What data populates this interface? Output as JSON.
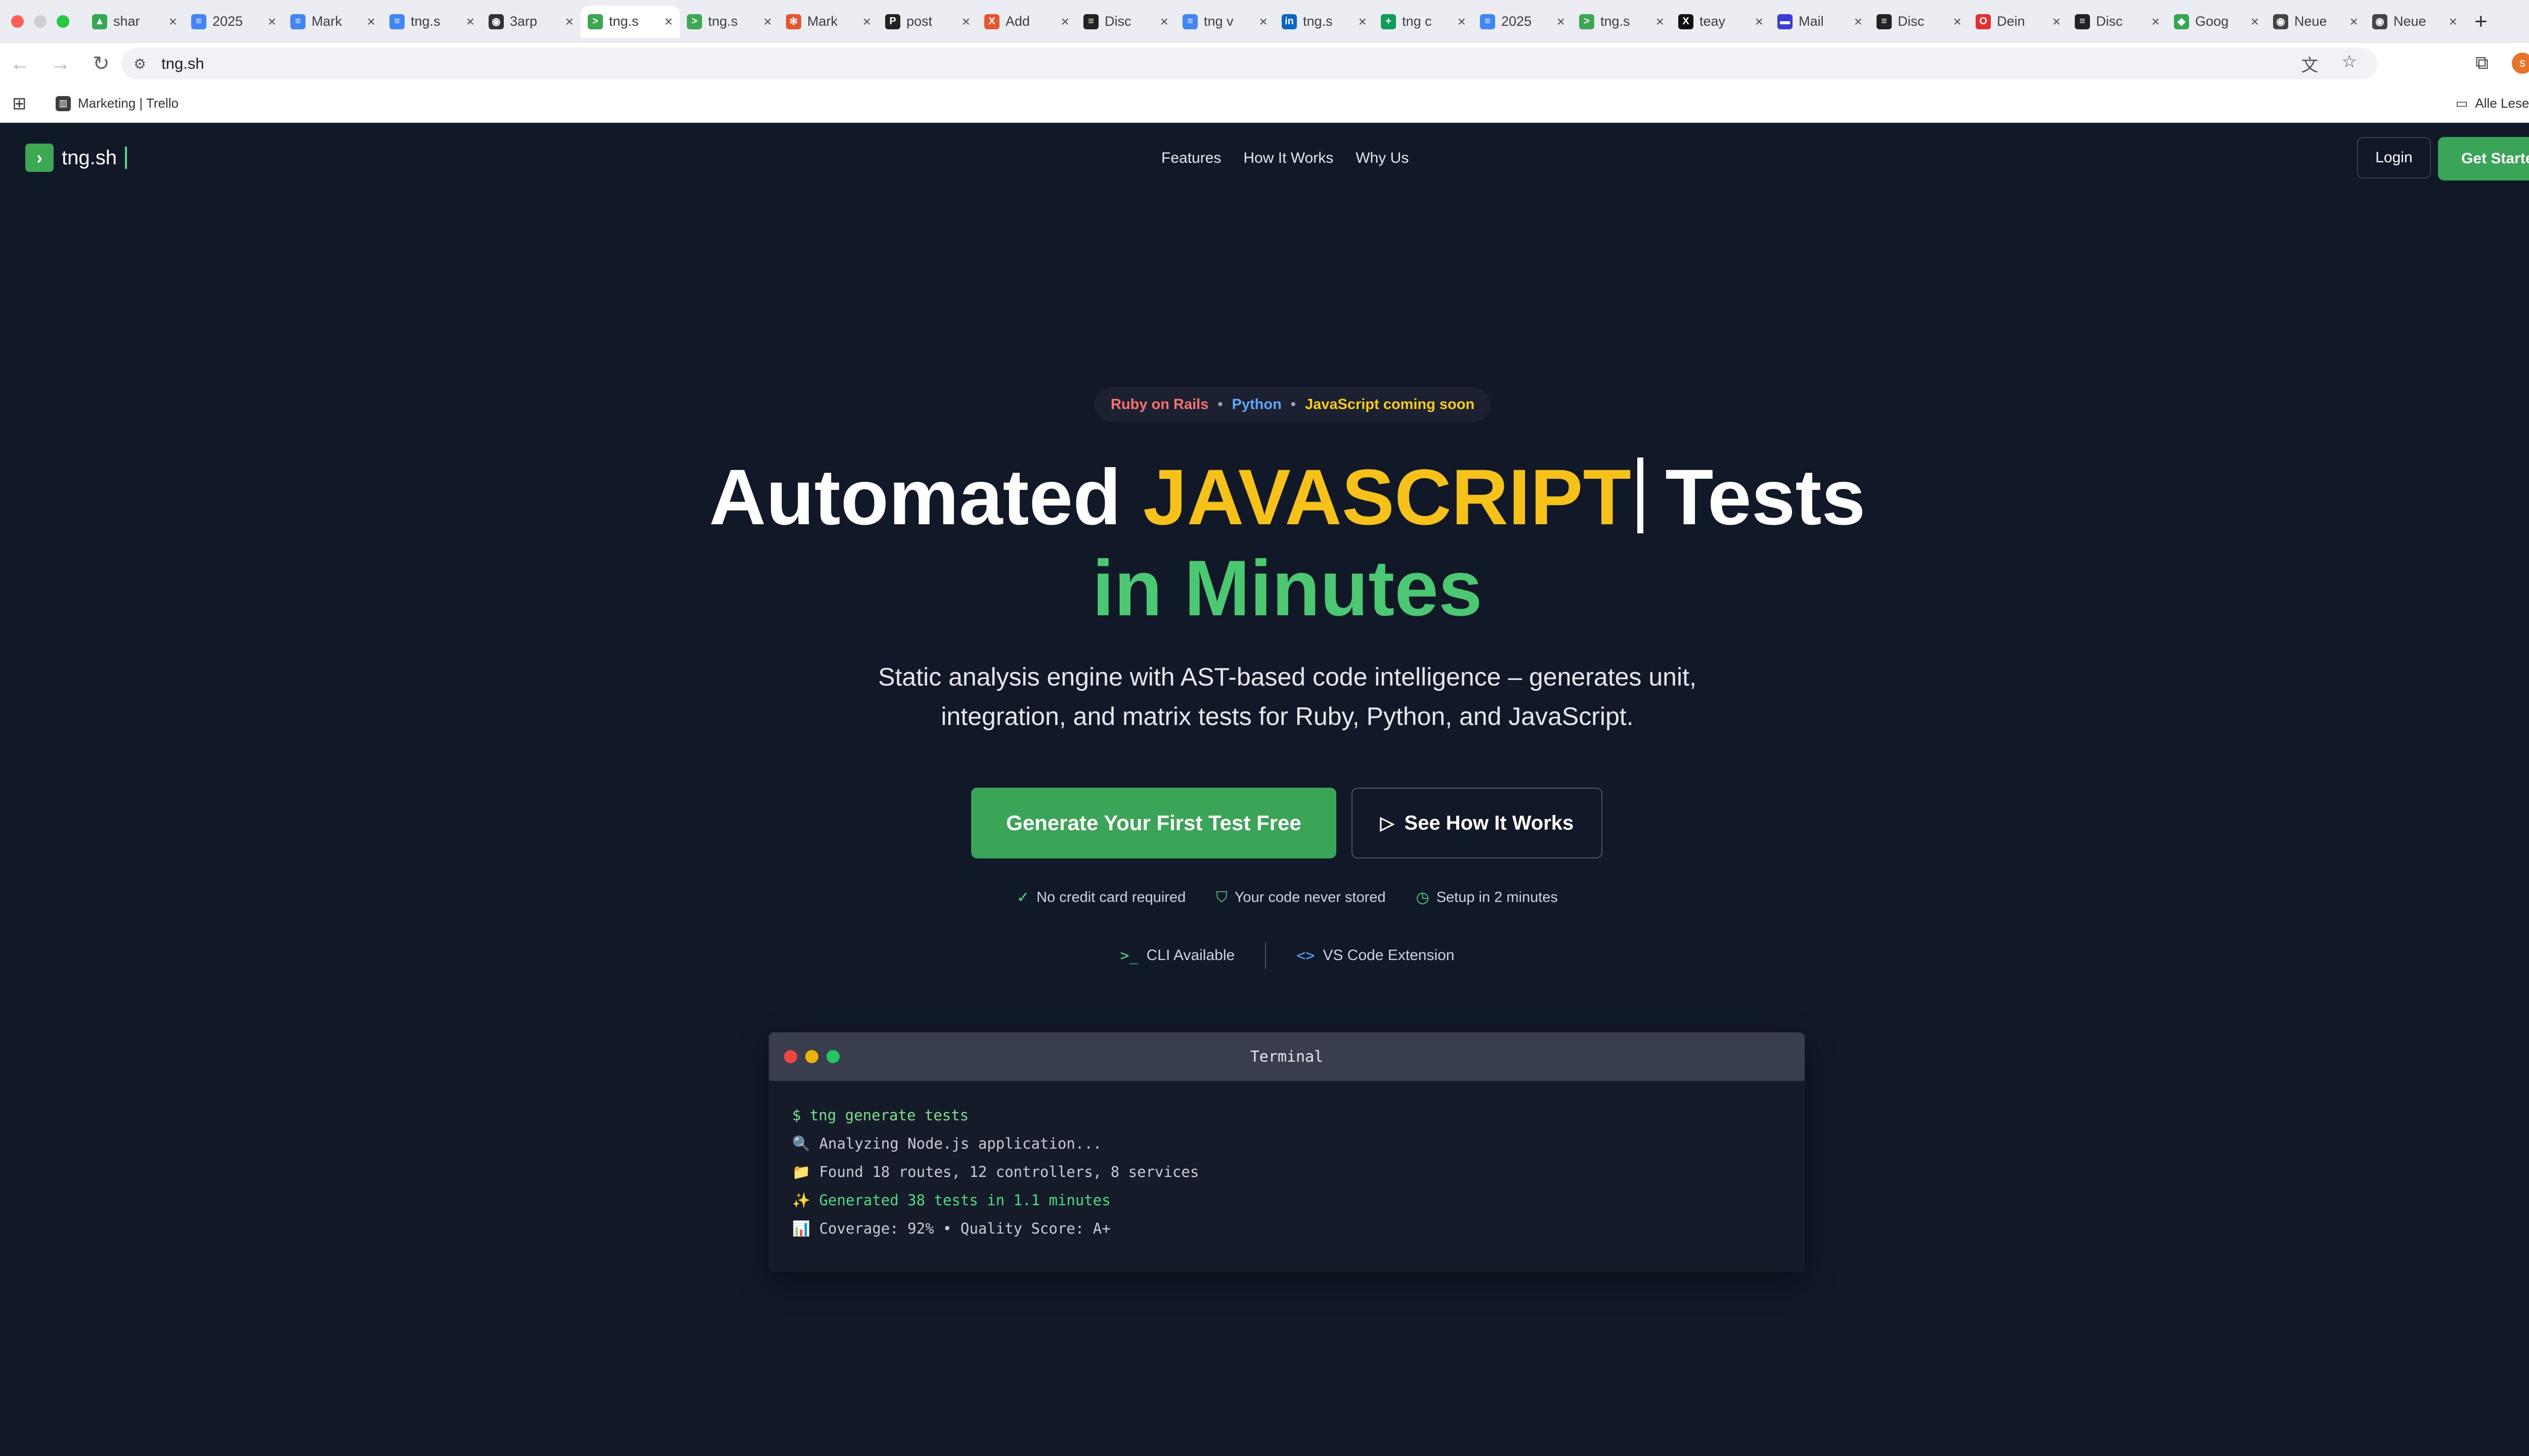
{
  "browser": {
    "tabs": [
      {
        "title": "shar",
        "color": "#34a853",
        "glyph": "▲"
      },
      {
        "title": "2025",
        "color": "#4285f4",
        "glyph": "≡"
      },
      {
        "title": "Mark",
        "color": "#4285f4",
        "glyph": "≡"
      },
      {
        "title": "tng.s",
        "color": "#4285f4",
        "glyph": "≡"
      },
      {
        "title": "3arp",
        "color": "#333333",
        "glyph": "◉"
      },
      {
        "title": "tng.s",
        "color": "#3ca852",
        "glyph": ">"
      },
      {
        "title": "tng.s",
        "color": "#3ca852",
        "glyph": ">"
      },
      {
        "title": "Mark",
        "color": "#e8542c",
        "glyph": "✻"
      },
      {
        "title": "post",
        "color": "#222222",
        "glyph": "P"
      },
      {
        "title": "Add",
        "color": "#e8542c",
        "glyph": "X"
      },
      {
        "title": "Disc",
        "color": "#222222",
        "glyph": "≡"
      },
      {
        "title": "tng v",
        "color": "#4285f4",
        "glyph": "≡"
      },
      {
        "title": "tng.s",
        "color": "#0a66c2",
        "glyph": "in"
      },
      {
        "title": "tng c",
        "color": "#0f9d58",
        "glyph": "+"
      },
      {
        "title": "2025",
        "color": "#4285f4",
        "glyph": "≡"
      },
      {
        "title": "tng.s",
        "color": "#3ca852",
        "glyph": ">"
      },
      {
        "title": "teay",
        "color": "#111111",
        "glyph": "X"
      },
      {
        "title": "Mail",
        "color": "#3b3bd6",
        "glyph": "▬"
      },
      {
        "title": "Disc",
        "color": "#222222",
        "glyph": "≡"
      },
      {
        "title": "Dein",
        "color": "#e03030",
        "glyph": "O"
      },
      {
        "title": "Disc",
        "color": "#222222",
        "glyph": "≡"
      },
      {
        "title": "Goog",
        "color": "#34a853",
        "glyph": "◆"
      },
      {
        "title": "Neue",
        "color": "#444444",
        "glyph": "◉"
      },
      {
        "title": "Neue",
        "color": "#444444",
        "glyph": "◉"
      }
    ],
    "active_tab_index": 5,
    "url": "tng.sh",
    "bookmark_label": "Marketing | Trello",
    "all_bookmarks_label": "Alle Lesezeichen",
    "profile_initial": "s"
  },
  "site": {
    "logo_text": "tng.sh",
    "nav": {
      "links": [
        "Features",
        "How It Works",
        "Why Us"
      ],
      "login": "Login",
      "cta": "Get Started"
    },
    "langs": {
      "ruby": "Ruby on Rails",
      "python": "Python",
      "js": "JavaScript coming soon",
      "separator": "•"
    },
    "headline": {
      "part1": "Automated ",
      "highlight": "JAVASCRIPT",
      "part2": " Tests",
      "line2": "in Minutes"
    },
    "subheadline": "Static analysis engine with AST-based code intelligence – generates unit, integration, and matrix tests for Ruby, Python, and JavaScript.",
    "cta_primary": "Generate Your First Test Free",
    "cta_secondary": "See How It Works",
    "trust": [
      {
        "icon": "check-circle-icon",
        "label": "No credit card required"
      },
      {
        "icon": "shield-icon",
        "label": "Your code never stored"
      },
      {
        "icon": "clock-icon",
        "label": "Setup in 2 minutes"
      }
    ],
    "tools": {
      "cli": "CLI Available",
      "vscode": "VS Code Extension"
    },
    "terminal": {
      "title": "Terminal",
      "lines": [
        "$ tng generate tests",
        "🔍 Analyzing Node.js application...",
        "📁 Found 18 routes, 12 controllers, 8 services",
        "✨ Generated 38 tests in 1.1 minutes",
        "📊 Coverage: 92% • Quality Score: A+"
      ]
    },
    "colors": {
      "background": "#111827",
      "accent_green": "#3aa557",
      "highlight_yellow": "#f6c21a",
      "ruby_red": "#f87171",
      "python_blue": "#60a5fa",
      "js_yellow": "#facc15"
    }
  }
}
